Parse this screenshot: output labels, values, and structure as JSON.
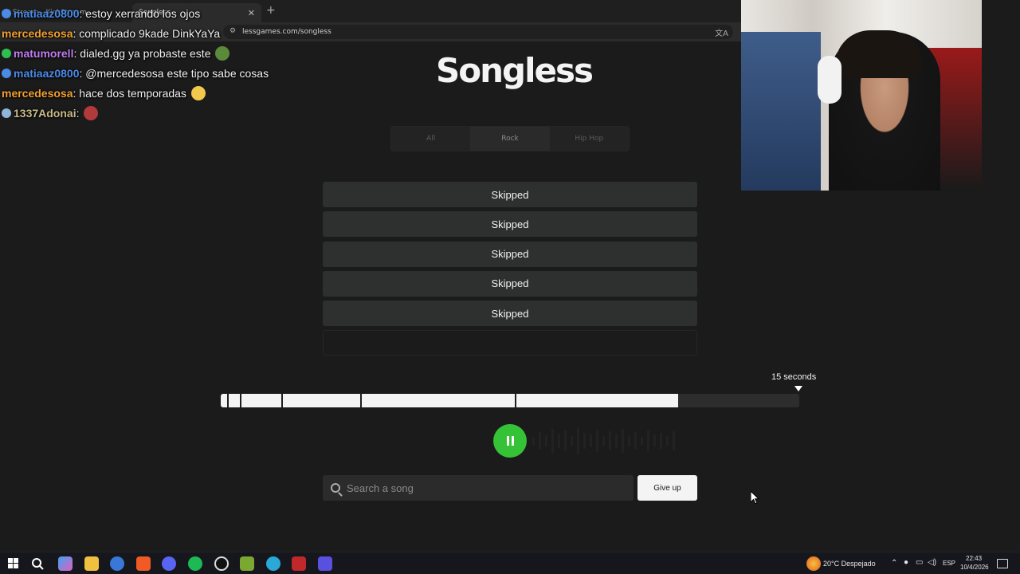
{
  "browser": {
    "tabs": [
      {
        "label": "Stream - KickStream"
      },
      {
        "label": "Songless"
      }
    ],
    "new_tab": "+",
    "url": "lessgames.com/songless"
  },
  "chat": [
    {
      "user": "matiaaz0800",
      "message": ": estoy xerrando los ojos",
      "color": "#4b8be8"
    },
    {
      "user": "mercedesosa",
      "message": ": complicado 9kade DinkYaYa",
      "color": "#f0a030"
    },
    {
      "user": "matumorell",
      "message": ": dialed.gg ya probaste este",
      "color": "#c07cf0"
    },
    {
      "user": "matiaaz0800",
      "message": ": @mercedesosa este tipo sabe cosas",
      "color": "#4b8be8"
    },
    {
      "user": "mercedesosa",
      "message": ": hace dos temporadas",
      "color": "#f0a030"
    },
    {
      "user": "1337Adonai",
      "message": ":",
      "color": "#c9b98a"
    }
  ],
  "game": {
    "title": "Songless",
    "categories": [
      {
        "label": "All",
        "active": false
      },
      {
        "label": "Rock",
        "active": true
      },
      {
        "label": "Hip Hop",
        "active": false
      }
    ],
    "guesses": [
      "Skipped",
      "Skipped",
      "Skipped",
      "Skipped",
      "Skipped",
      ""
    ],
    "timeline_label": "15 seconds",
    "progress_fraction": 0.79,
    "segment_fractions": [
      0.011,
      0.033,
      0.105,
      0.241,
      0.508
    ],
    "search_placeholder": "Search a song",
    "give_up_label": "Give up",
    "accent_color": "#36c236"
  },
  "taskbar": {
    "weather": "20°C  Despejado",
    "language": "ESP",
    "time": "22:43",
    "date": "10/4/2026"
  }
}
